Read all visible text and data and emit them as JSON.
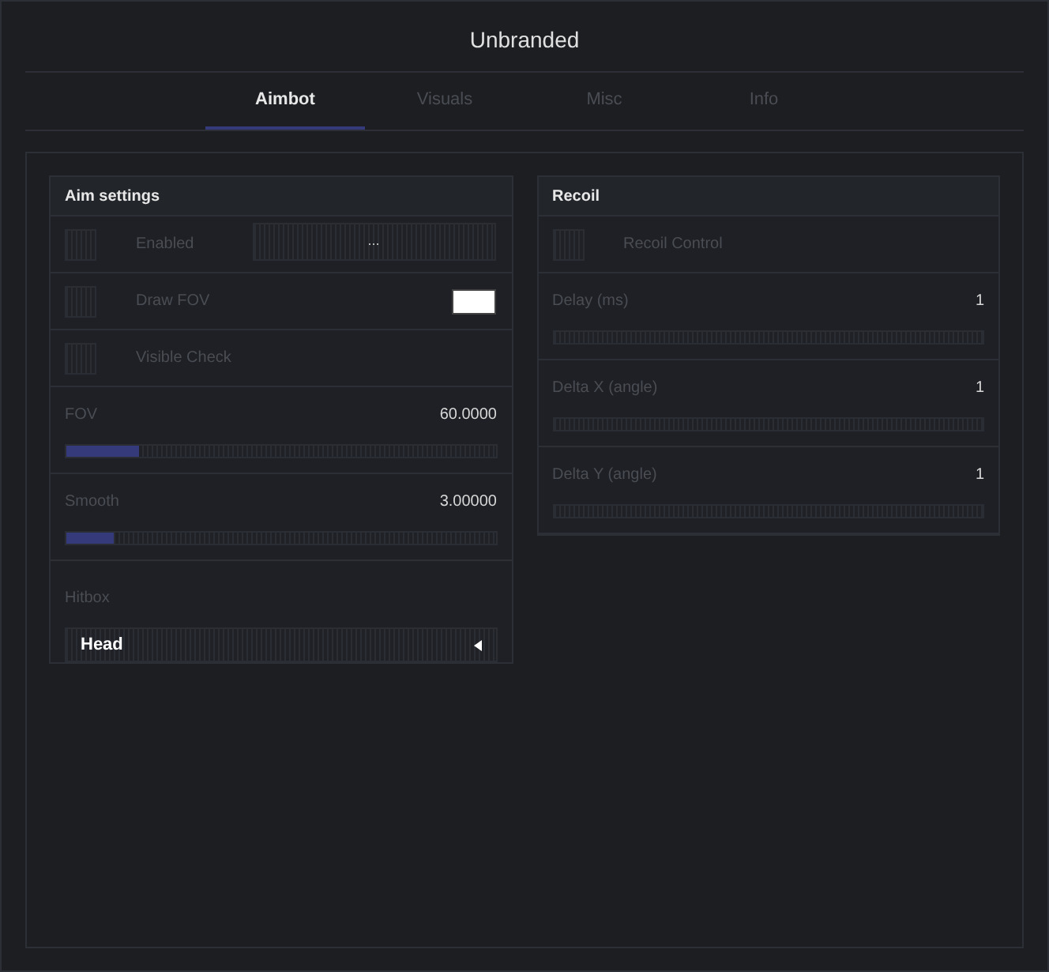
{
  "window": {
    "title": "Unbranded"
  },
  "tabs": [
    {
      "label": "Aimbot",
      "selected": true
    },
    {
      "label": "Visuals",
      "selected": false
    },
    {
      "label": "Misc",
      "selected": false
    },
    {
      "label": "Info",
      "selected": false
    }
  ],
  "panels": [
    {
      "title": "Aim settings",
      "rows": [
        {
          "kind": "checkbox",
          "label": "Enabled",
          "checked": false,
          "keybind": "..."
        },
        {
          "kind": "checkbox",
          "label": "Draw FOV",
          "checked": false,
          "color": "#ffffff"
        },
        {
          "kind": "checkbox",
          "label": "Visible Check",
          "checked": false
        },
        {
          "kind": "slider",
          "label": "FOV",
          "reading": "60.0000",
          "level": 0.17
        },
        {
          "kind": "slider",
          "label": "Smooth",
          "reading": "3.00000",
          "level": 0.11
        },
        {
          "kind": "dropdown",
          "label": "Hitbox",
          "value": "Head"
        }
      ]
    },
    {
      "title": "Recoil",
      "rows": [
        {
          "kind": "checkbox",
          "label": "Recoil Control",
          "checked": false
        },
        {
          "kind": "slider",
          "label": "Delay (ms)",
          "reading": "1"
        },
        {
          "kind": "slider",
          "label": "Delta X (angle)",
          "reading": "1"
        },
        {
          "kind": "slider",
          "label": "Delta Y (angle)",
          "reading": "1"
        }
      ]
    }
  ]
}
